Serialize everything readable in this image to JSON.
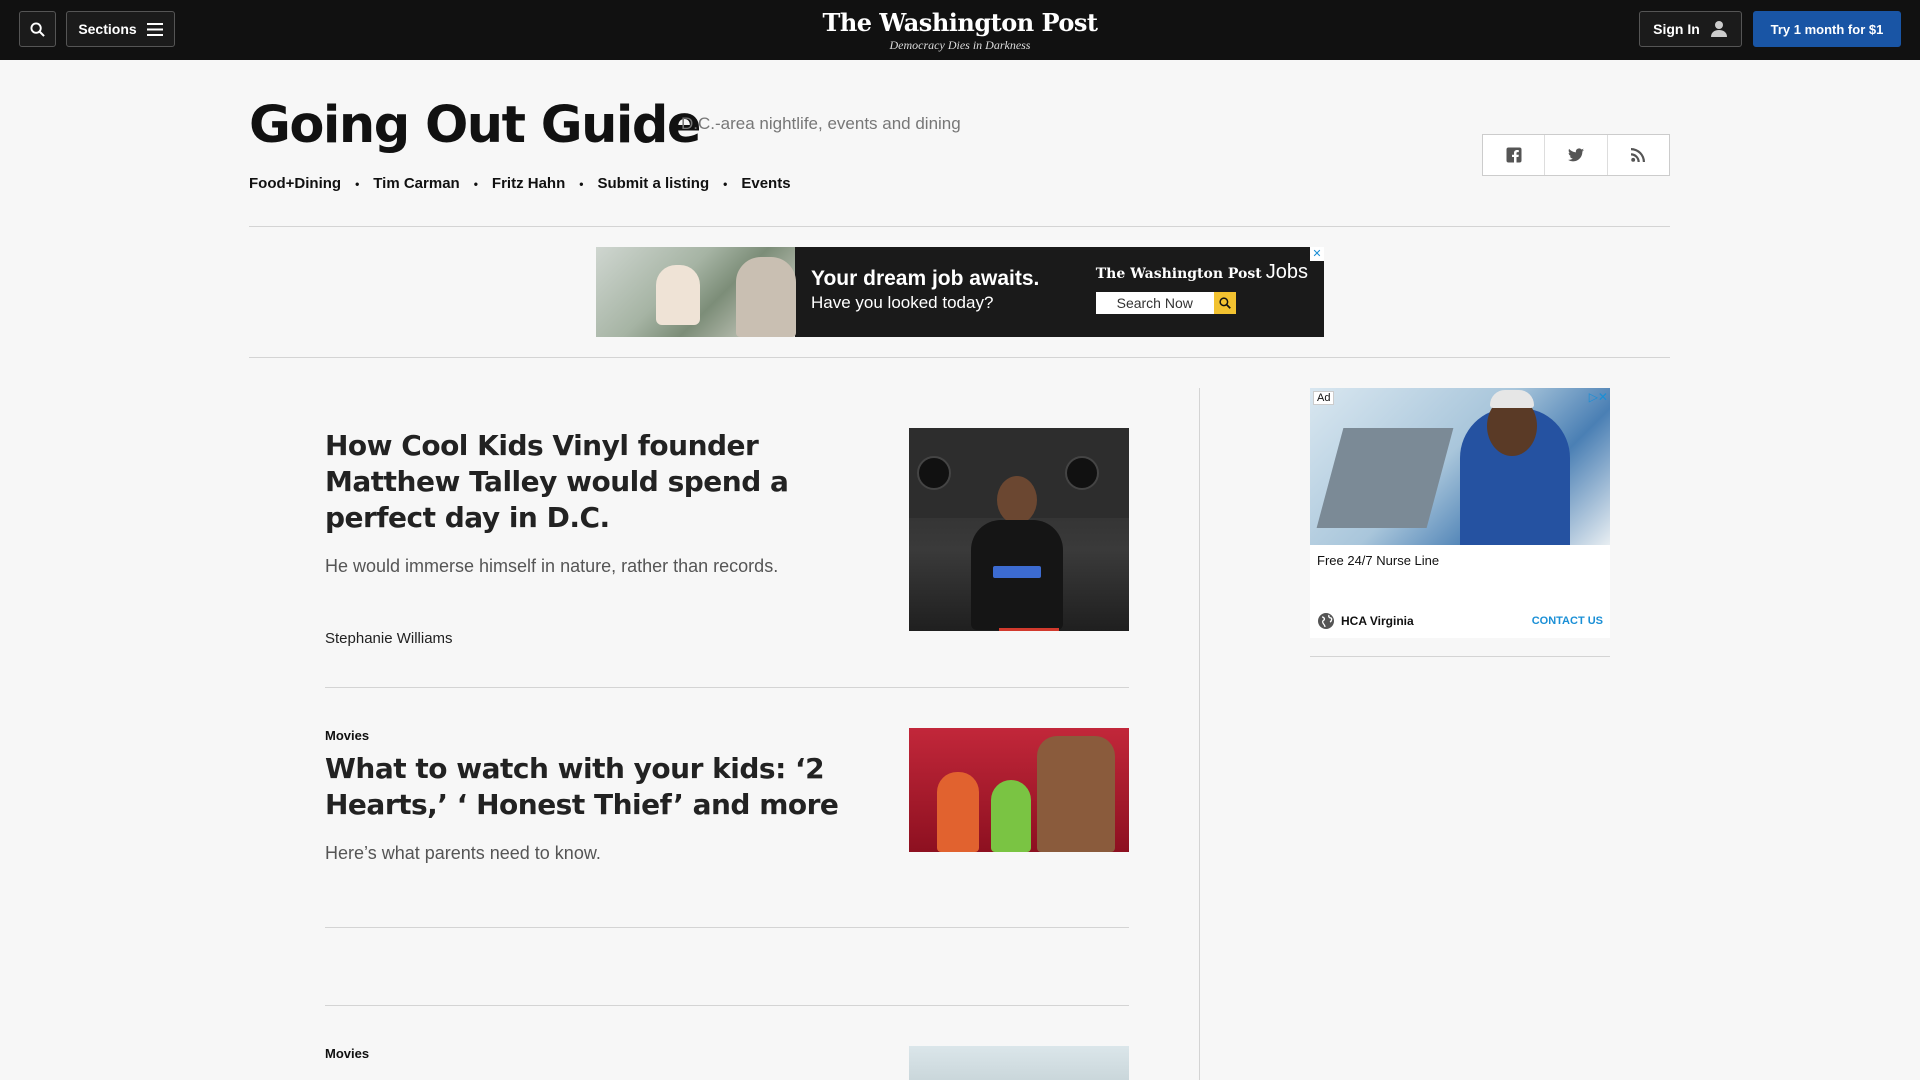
{
  "topbar": {
    "sections_label": "Sections",
    "signin_label": "Sign In",
    "try_label": "Try 1 month for $1",
    "masthead": "The Washington Post",
    "tagline": "Democracy Dies in Darkness"
  },
  "section": {
    "title": "Going Out Guide",
    "subtitle": "D.C.-area nightlife, events and dining",
    "nav": [
      "Food+Dining",
      "Tim Carman",
      "Fritz Hahn",
      "Submit a listing",
      "Events"
    ]
  },
  "banner_ad": {
    "headline": "Your dream job awaits.",
    "subline": "Have you looked today?",
    "brand": "The Washington Post",
    "brand_suffix": "Jobs",
    "search_label": "Search Now"
  },
  "articles": [
    {
      "kicker": "",
      "headline": "How Cool Kids Vinyl founder Matthew Talley would spend a perfect day in D.C.",
      "blurb": "He would immerse himself in nature, rather than records.",
      "byline": "Stephanie Williams"
    },
    {
      "kicker": "Movies",
      "headline": "What to watch with your kids: ‘2 Hearts,’ ‘ Honest Thief’ and more",
      "blurb": "Here’s what parents need to know.",
      "byline": ""
    },
    {
      "kicker": "Movies",
      "headline": "",
      "blurb": "",
      "byline": ""
    }
  ],
  "side_ad": {
    "ad_tag": "Ad",
    "title": "Free 24/7 Nurse Line",
    "advertiser": "HCA Virginia",
    "cta": "CONTACT US"
  },
  "colors": {
    "topbar": "#111111",
    "accent": "#1955a5",
    "link": "#1a8fd6"
  },
  "icons": [
    "search-icon",
    "menu-icon",
    "user-icon",
    "facebook-icon",
    "twitter-icon",
    "rss-icon"
  ]
}
